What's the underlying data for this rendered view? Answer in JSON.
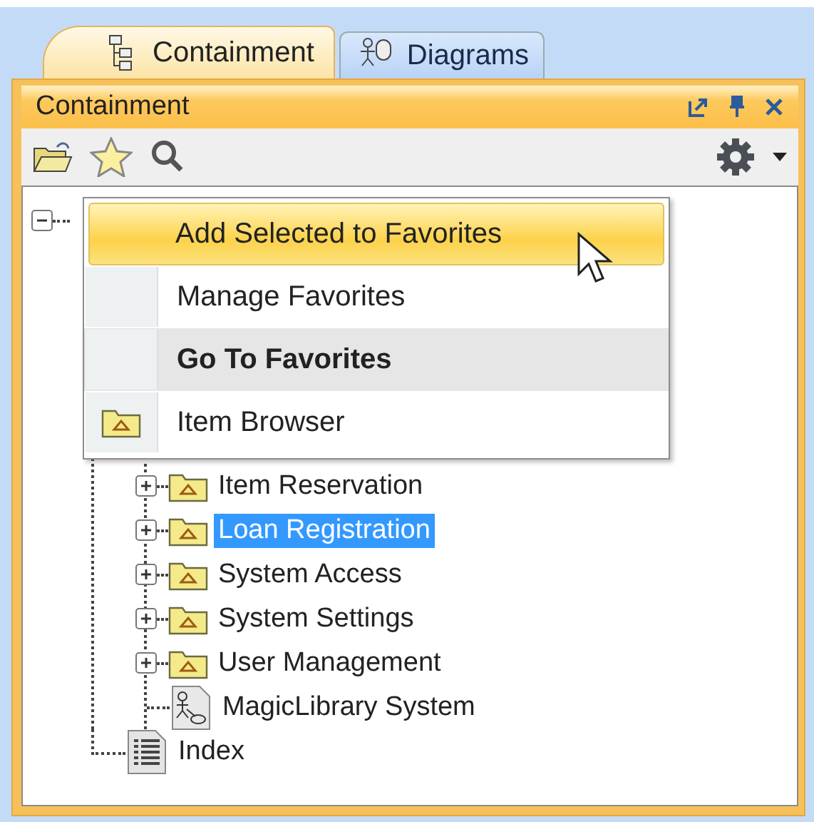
{
  "tabs": [
    {
      "label": "Containment",
      "selected": true
    },
    {
      "label": "Diagrams",
      "selected": false
    }
  ],
  "panel": {
    "title": "Containment"
  },
  "tree": {
    "expanded": true,
    "children": [
      {
        "label": "Item Reservation",
        "kind": "package",
        "expanded": false,
        "selected": false
      },
      {
        "label": "Loan Registration",
        "kind": "package",
        "expanded": false,
        "selected": true
      },
      {
        "label": "System Access",
        "kind": "package",
        "expanded": false,
        "selected": false
      },
      {
        "label": "System Settings",
        "kind": "package",
        "expanded": false,
        "selected": false
      },
      {
        "label": "User Management",
        "kind": "package",
        "expanded": false,
        "selected": false
      },
      {
        "label": "MagicLibrary System",
        "kind": "diagram",
        "selected": false
      }
    ],
    "footer": {
      "label": "Index",
      "kind": "index",
      "selected": false
    }
  },
  "menu": [
    {
      "label": "Add Selected to Favorites",
      "kind": "plain",
      "highlighted": true,
      "bold": false
    },
    {
      "label": "Manage Favorites",
      "kind": "plain",
      "highlighted": false,
      "bold": false
    },
    {
      "label": "Go To Favorites",
      "kind": "plain",
      "highlighted": false,
      "bold": true
    },
    {
      "label": "Item Browser",
      "kind": "package",
      "highlighted": false,
      "bold": false
    }
  ]
}
